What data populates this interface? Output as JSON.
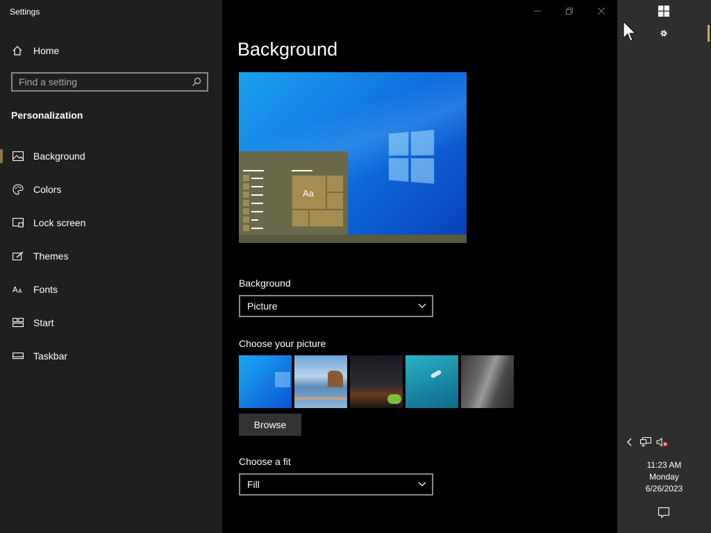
{
  "window": {
    "title": "Settings"
  },
  "sidebar": {
    "home_label": "Home",
    "search_placeholder": "Find a setting",
    "section_title": "Personalization",
    "items": [
      {
        "label": "Background",
        "icon": "image-icon",
        "active": true
      },
      {
        "label": "Colors",
        "icon": "palette-icon"
      },
      {
        "label": "Lock screen",
        "icon": "lock-screen-icon"
      },
      {
        "label": "Themes",
        "icon": "themes-icon"
      },
      {
        "label": "Fonts",
        "icon": "fonts-icon"
      },
      {
        "label": "Start",
        "icon": "start-icon"
      },
      {
        "label": "Taskbar",
        "icon": "taskbar-icon"
      }
    ]
  },
  "main": {
    "title": "Background",
    "preview": {
      "sample_text": "Aa"
    },
    "background_label": "Background",
    "background_value": "Picture",
    "choose_picture_label": "Choose your picture",
    "browse_label": "Browse",
    "choose_fit_label": "Choose a fit",
    "fit_value": "Fill"
  },
  "tray": {
    "time": "11:23 AM",
    "day": "Monday",
    "date": "6/26/2023"
  },
  "colors": {
    "sidebar_bg": "#1f1f1f",
    "main_bg": "#000000",
    "accent": "#8a7a3e",
    "tray_bg": "#2e2e2e"
  }
}
